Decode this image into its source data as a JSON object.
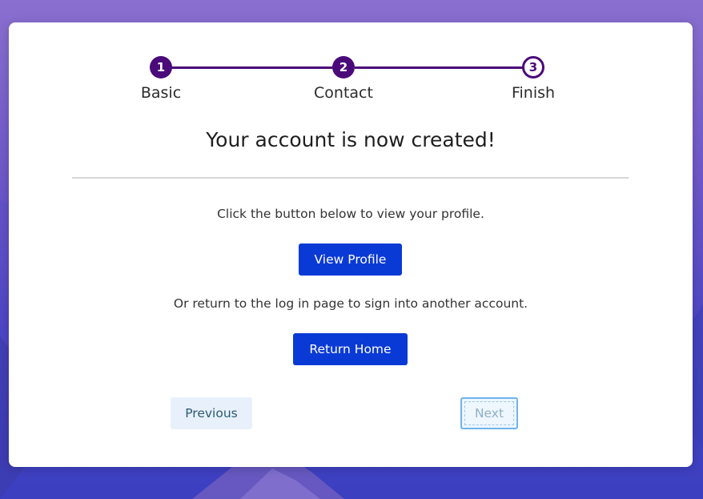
{
  "stepper": {
    "steps": [
      {
        "number": "1",
        "label": "Basic",
        "state": "done"
      },
      {
        "number": "2",
        "label": "Contact",
        "state": "done"
      },
      {
        "number": "3",
        "label": "Finish",
        "state": "active"
      }
    ],
    "color": "#4b0a7a"
  },
  "main": {
    "heading": "Your account is now created!",
    "profile_message": "Click the button below to view your profile.",
    "view_profile_label": "View Profile",
    "login_message": "Or return to the log in page to sign into another account.",
    "return_home_label": "Return Home"
  },
  "nav": {
    "previous_label": "Previous",
    "next_label": "Next"
  },
  "colors": {
    "primary_button": "#0a3ad6",
    "previous_button_bg": "#e8f1fb",
    "next_focus_border": "#6fb3f0"
  }
}
